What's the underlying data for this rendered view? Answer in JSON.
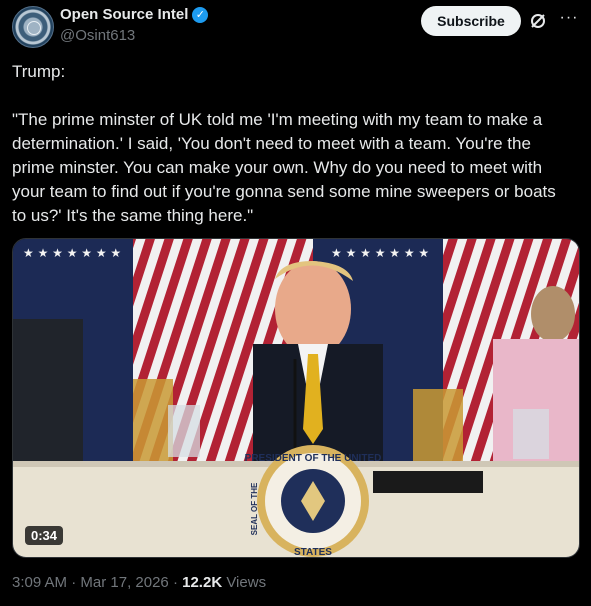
{
  "account": {
    "name": "Open Source Intel",
    "handle": "@Osint613"
  },
  "actions": {
    "subscribe_label": "Subscribe",
    "grok_icon": "grok-icon",
    "more_icon": "more-icon"
  },
  "tweet": {
    "text": "Trump:\n\n\"The prime minster of UK told me 'I'm meeting with my team to make a determination.' I said, 'You don't need to meet with a team. You're the prime minster. You can make your own. Why do you need to meet with your team to find out if you're gonna send some mine sweepers or boats to us?' It's the same thing here.\""
  },
  "media": {
    "duration": "0:34",
    "seal_text_top": "PRESIDENT OF THE UNITED",
    "seal_text_bottom": "STATES",
    "seal_text_left": "SEAL OF THE"
  },
  "meta": {
    "time": "3:09 AM",
    "date": "Mar 17, 2026",
    "views_count": "12.2K",
    "views_label": "Views",
    "separator": "·"
  },
  "colors": {
    "accent": "#1d9bf0",
    "background": "#000000",
    "text": "#e7e9ea",
    "muted": "#71767b"
  }
}
